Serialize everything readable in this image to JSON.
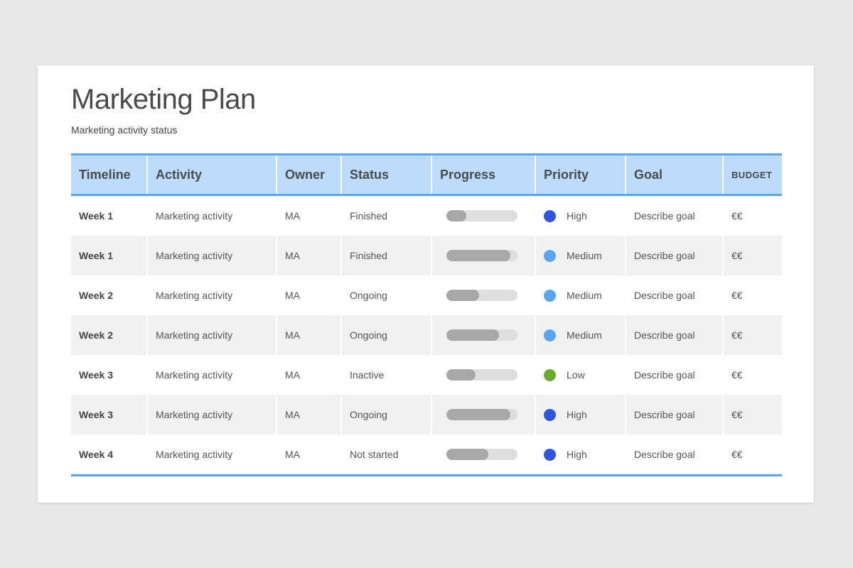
{
  "title": "Marketing Plan",
  "subtitle": "Marketing activity status",
  "headers": {
    "timeline": "Timeline",
    "activity": "Activity",
    "owner": "Owner",
    "status": "Status",
    "progress": "Progress",
    "priority": "Priority",
    "goal": "Goal",
    "budget": "BUDGET"
  },
  "colors": {
    "header_bg": "#bddcfc",
    "rule": "#58a6f3",
    "high": "#2f55e0",
    "medium": "#58a6f3",
    "low": "#6aab2e",
    "bar_fill": "#a8a8a8",
    "bar_track": "#dedede"
  },
  "rows": [
    {
      "timeline": "Week 1",
      "activity": "Marketing activity",
      "owner": "MA",
      "status": "Finished",
      "progress": 0.28,
      "priority": "High",
      "priority_level": "high",
      "goal": "Describe goal",
      "budget": "€€"
    },
    {
      "timeline": "Week 1",
      "activity": "Marketing activity",
      "owner": "MA",
      "status": "Finished",
      "progress": 0.9,
      "priority": "Medium",
      "priority_level": "medium",
      "goal": "Describe goal",
      "budget": "€€"
    },
    {
      "timeline": "Week 2",
      "activity": "Marketing activity",
      "owner": "MA",
      "status": "Ongoing",
      "progress": 0.46,
      "priority": "Medium",
      "priority_level": "medium",
      "goal": "Describe goal",
      "budget": "€€"
    },
    {
      "timeline": "Week 2",
      "activity": "Marketing activity",
      "owner": "MA",
      "status": "Ongoing",
      "progress": 0.74,
      "priority": "Medium",
      "priority_level": "medium",
      "goal": "Describe goal",
      "budget": "€€"
    },
    {
      "timeline": "Week 3",
      "activity": "Marketing activity",
      "owner": "MA",
      "status": "Inactive",
      "progress": 0.41,
      "priority": "Low",
      "priority_level": "low",
      "goal": "Describe goal",
      "budget": "€€"
    },
    {
      "timeline": "Week 3",
      "activity": "Marketing activity",
      "owner": "MA",
      "status": "Ongoing",
      "progress": 0.9,
      "priority": "High",
      "priority_level": "high",
      "goal": "Describe goal",
      "budget": "€€"
    },
    {
      "timeline": "Week 4",
      "activity": "Marketing activity",
      "owner": "MA",
      "status": "Not started",
      "progress": 0.59,
      "priority": "High",
      "priority_level": "high",
      "goal": "Describe goal",
      "budget": "€€"
    }
  ]
}
